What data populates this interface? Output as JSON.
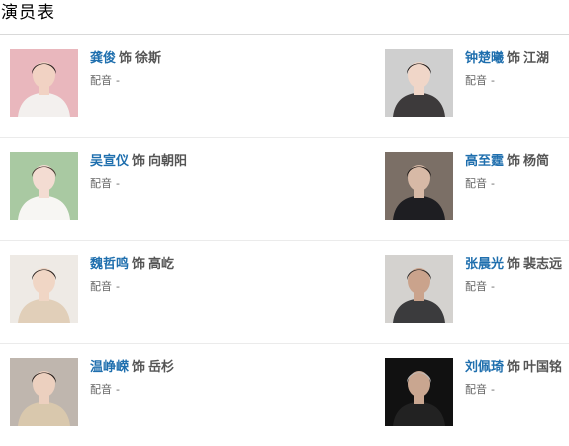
{
  "section": {
    "title": "演员表"
  },
  "labels": {
    "as": "饰",
    "dub": "配音",
    "dub_value": "-"
  },
  "cast": [
    {
      "actor": "龚俊",
      "role": "徐斯",
      "bg": "#e9b7bd",
      "skin": "#f1d2c3",
      "hair": "#2a2220",
      "cloth": "#f3f0ee"
    },
    {
      "actor": "钟楚曦",
      "role": "江湖",
      "bg": "#cfcfcf",
      "skin": "#f0d6c8",
      "hair": "#1e1a19",
      "cloth": "#3d3a3b"
    },
    {
      "actor": "吴宣仪",
      "role": "向朝阳",
      "bg": "#a9c9a2",
      "skin": "#f3dcd2",
      "hair": "#4a3a33",
      "cloth": "#f7f6f3"
    },
    {
      "actor": "高至霆",
      "role": "杨简",
      "bg": "#7b6f66",
      "skin": "#d7b9a6",
      "hair": "#1c1715",
      "cloth": "#1e1e22"
    },
    {
      "actor": "魏哲鸣",
      "role": "高屹",
      "bg": "#eeeae5",
      "skin": "#f0d6c5",
      "hair": "#2a2320",
      "cloth": "#e1cfb9"
    },
    {
      "actor": "张晨光",
      "role": "裴志远",
      "bg": "#d4d2cf",
      "skin": "#caa38c",
      "hair": "#2a2624",
      "cloth": "#3b3b3d"
    },
    {
      "actor": "温峥嵘",
      "role": "岳杉",
      "bg": "#bfb6ae",
      "skin": "#ecd0bf",
      "hair": "#221b18",
      "cloth": "#d9c8ad"
    },
    {
      "actor": "刘佩琦",
      "role": "叶国铭",
      "bg": "#111111",
      "skin": "#c9a690",
      "hair": "#bdbdbd",
      "cloth": "#222222"
    }
  ]
}
